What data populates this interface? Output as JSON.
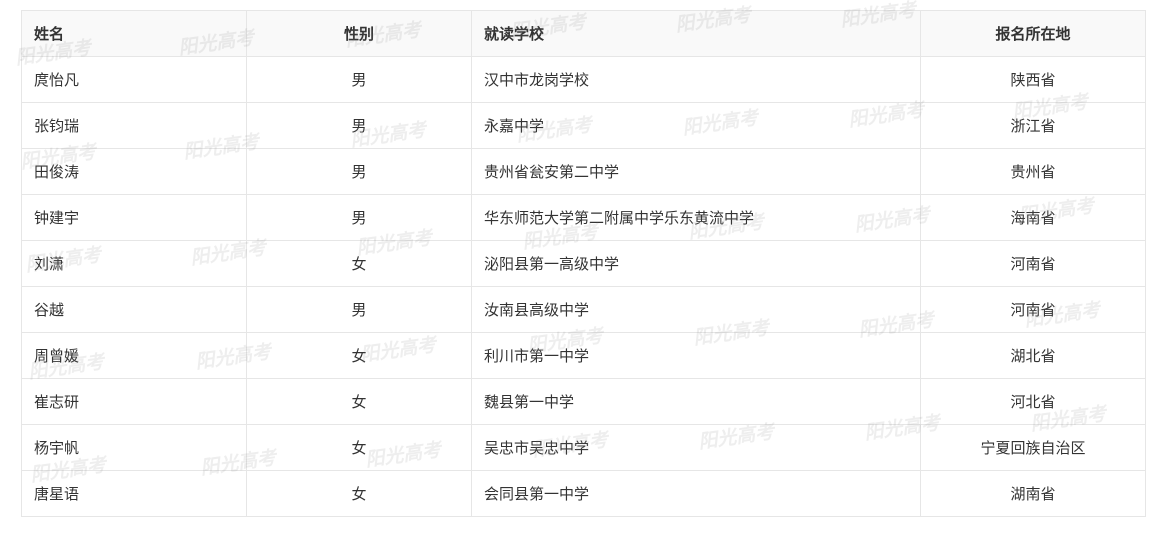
{
  "table": {
    "headers": {
      "name": "姓名",
      "gender": "性别",
      "school": "就读学校",
      "place": "报名所在地"
    },
    "rows": [
      {
        "name": "庹怡凡",
        "gender": "男",
        "school": "汉中市龙岗学校",
        "place": "陕西省"
      },
      {
        "name": "张钧瑞",
        "gender": "男",
        "school": "永嘉中学",
        "place": "浙江省"
      },
      {
        "name": "田俊涛",
        "gender": "男",
        "school": "贵州省瓮安第二中学",
        "place": "贵州省"
      },
      {
        "name": "钟建宇",
        "gender": "男",
        "school": "华东师范大学第二附属中学乐东黄流中学",
        "place": "海南省"
      },
      {
        "name": "刘潇",
        "gender": "女",
        "school": "泌阳县第一高级中学",
        "place": "河南省"
      },
      {
        "name": "谷越",
        "gender": "男",
        "school": "汝南县高级中学",
        "place": "河南省"
      },
      {
        "name": "周曾媛",
        "gender": "女",
        "school": "利川市第一中学",
        "place": "湖北省"
      },
      {
        "name": "崔志研",
        "gender": "女",
        "school": "魏县第一中学",
        "place": "河北省"
      },
      {
        "name": "杨宇帆",
        "gender": "女",
        "school": "吴忠市吴忠中学",
        "place": "宁夏回族自治区"
      },
      {
        "name": "唐星语",
        "gender": "女",
        "school": "会同县第一中学",
        "place": "湖南省"
      }
    ]
  },
  "watermark": {
    "text": "阳光高考"
  }
}
